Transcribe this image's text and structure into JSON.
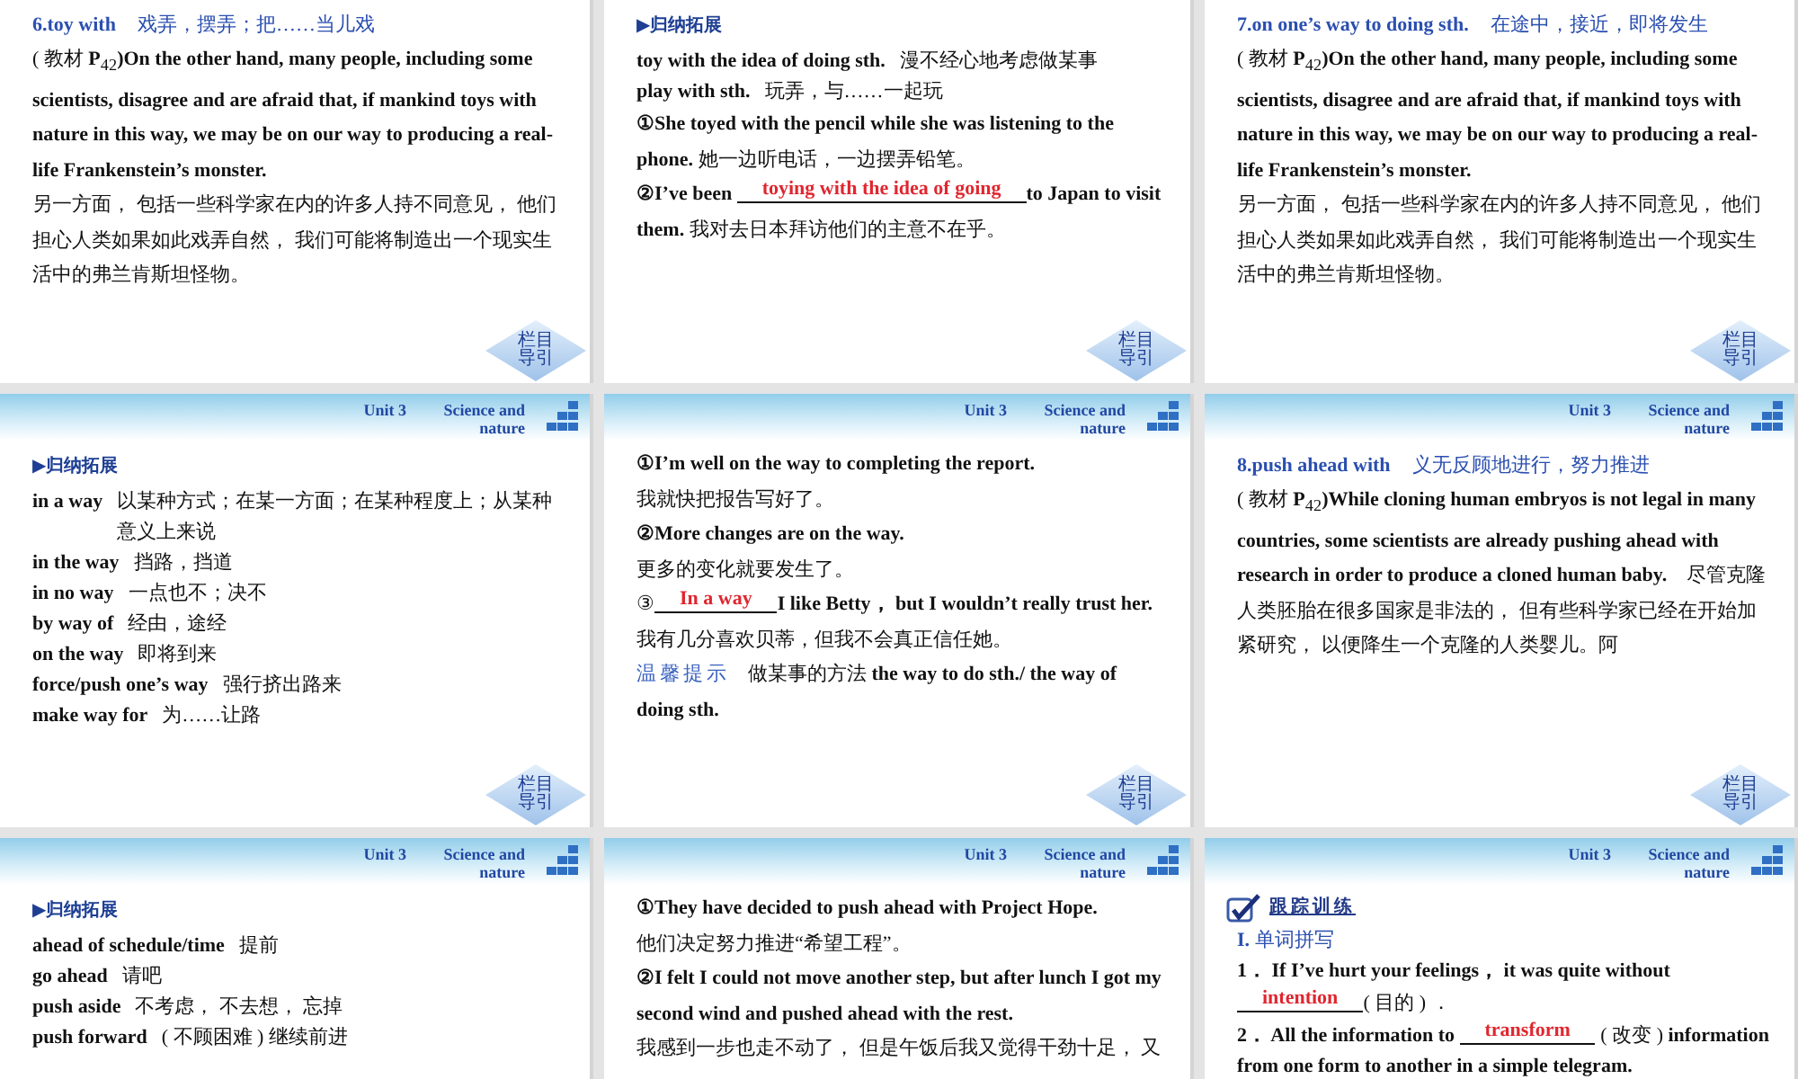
{
  "slides": [
    {
      "nav": "栏目导引",
      "lines": [
        {
          "kind": "heading",
          "term": "6.toy with",
          "meaning": "戏弄，摆弄；把……当儿戏"
        },
        {
          "kind": "para",
          "text": "( 教材 **P**$_{42}$**)On the other hand, many people, including some scientists, disagree and are afraid that, if mankind toys with nature in this way, we may be on our way to producing a real-life Frankenstein’s monster.**"
        },
        {
          "kind": "para",
          "text": "另一方面， 包括一些科学家在内的许多人持不同意见， 他们担心人类如果如此戏弄自然， 我们可能将制造出一个现实生活中的弗兰肯斯坦怪物。"
        }
      ]
    },
    {
      "nav": "栏目导引",
      "lines": [
        {
          "kind": "section",
          "text": "▶归纳拓展"
        },
        {
          "kind": "term",
          "term": "toy with the idea of doing sth.",
          "meaning": "漫不经心地考虑做某事"
        },
        {
          "kind": "term",
          "term": "play with sth.",
          "meaning": "玩弄，与……一起玩"
        },
        {
          "kind": "para",
          "text": "**①She toyed with the pencil while she was listening to the phone.** 她一边听电话，一边摆弄铅笔。"
        },
        {
          "kind": "fill",
          "before": "**②I’ve been** ",
          "answer": "toying with the idea of going",
          "after": "**to Japan to visit them.** 我对去日本拜访他们的主意不在乎。"
        }
      ]
    },
    {
      "nav": "栏目导引",
      "lines": [
        {
          "kind": "heading",
          "term": "7.on one’s way to doing sth.",
          "meaning": "在途中，接近，即将发生"
        },
        {
          "kind": "para",
          "text": "( 教材 **P**$_{42}$**)On the other hand, many people, including some scientists, disagree and are afraid that, if mankind toys with nature in this way, we may be on our way to producing a real-life Frankenstein’s monster.**"
        },
        {
          "kind": "para",
          "text": "另一方面， 包括一些科学家在内的许多人持不同意见， 他们担心人类如果如此戏弄自然， 我们可能将制造出一个现实生活中的弗兰肯斯坦怪物。"
        }
      ]
    },
    {
      "header": {
        "unit": "Unit 3",
        "topic": "Science and nature"
      },
      "nav": "栏目导引",
      "lines": [
        {
          "kind": "section",
          "text": "▶归纳拓展"
        },
        {
          "kind": "term",
          "term": "in a way",
          "meaning": "以某种方式；在某一方面；在某种程度上；从某种意义上来说"
        },
        {
          "kind": "term",
          "term": "in the way",
          "meaning": "挡路，挡道"
        },
        {
          "kind": "term",
          "term": "in no way",
          "meaning": "一点也不；决不"
        },
        {
          "kind": "term",
          "term": "by way of",
          "meaning": "经由，途经"
        },
        {
          "kind": "term",
          "term": "on the way",
          "meaning": "即将到来"
        },
        {
          "kind": "term",
          "term": "force/push one’s way",
          "meaning": "强行挤出路来"
        },
        {
          "kind": "term",
          "term": "make way for",
          "meaning": "为……让路"
        }
      ]
    },
    {
      "header": {
        "unit": "Unit 3",
        "topic": "Science and nature"
      },
      "nav": "栏目导引",
      "lines": [
        {
          "kind": "para",
          "text": "**①I’m well on the way to completing the report.**"
        },
        {
          "kind": "para",
          "text": "我就快把报告写好了。"
        },
        {
          "kind": "para",
          "text": "**②More changes are on the way.**"
        },
        {
          "kind": "para",
          "text": "更多的变化就要发生了。"
        },
        {
          "kind": "fill",
          "before": "③",
          "answer": "In a way",
          "after": "**I like Betty， but I wouldn’t really trust her.**"
        },
        {
          "kind": "para",
          "text": "我有几分喜欢贝蒂，但我不会真正信任她。"
        },
        {
          "kind": "tip",
          "label": "温馨提示",
          "text": "做某事的方法 **the way to do sth./ the way of doing sth.**"
        }
      ]
    },
    {
      "header": {
        "unit": "Unit 3",
        "topic": "Science and nature"
      },
      "nav": "栏目导引",
      "lines": [
        {
          "kind": "heading",
          "term": "8.push ahead with",
          "meaning": "义无反顾地进行，努力推进"
        },
        {
          "kind": "para",
          "text": "( 教材 **P**$_{42}$**)While cloning human embryos is not legal in many countries, some scientists are already pushing ahead with research in order to produce a cloned human baby.**　尽管克隆人类胚胎在很多国家是非法的， 但有些科学家已经在开始加紧研究， 以便降生一个克隆的人类婴儿。阿"
        }
      ]
    },
    {
      "header": {
        "unit": "Unit 3",
        "topic": "Science and nature"
      },
      "lines": [
        {
          "kind": "section",
          "text": "▶归纳拓展"
        },
        {
          "kind": "term",
          "term": "ahead of schedule/time",
          "meaning": "提前"
        },
        {
          "kind": "term",
          "term": "go ahead",
          "meaning": "请吧"
        },
        {
          "kind": "term",
          "term": "push aside",
          "meaning": "不考虑， 不去想， 忘掉"
        },
        {
          "kind": "term",
          "term": "push forward",
          "meaning": "( 不顾困难 ) 继续前进"
        }
      ]
    },
    {
      "header": {
        "unit": "Unit 3",
        "topic": "Science and nature"
      },
      "lines": [
        {
          "kind": "para",
          "text": "**①They have decided to push ahead with Project Hope.**"
        },
        {
          "kind": "para",
          "text": "他们决定努力推进“希望工程”。"
        },
        {
          "kind": "para",
          "text": "**②I felt I could not move another step, but after lunch I got my second wind and pushed ahead with the rest.**"
        },
        {
          "kind": "para",
          "text": "我感到一步也走不动了， 但是午饭后我又觉得干劲十足， 又"
        }
      ]
    },
    {
      "header": {
        "unit": "Unit 3",
        "topic": "Science and nature"
      },
      "lines": [
        {
          "kind": "practice",
          "text": "跟踪训练"
        },
        {
          "kind": "subhead",
          "text": "**I.** 单词拼写"
        },
        {
          "kind": "exercise",
          "before": "**1． If I’ve hurt your feelings， it was quite without**",
          "answer": "intention",
          "after": "( 目的 ) ．"
        },
        {
          "kind": "exercise",
          "before": "**2． All the information to** ",
          "answer": "transform",
          "after": " ( 改变 ) **information from one form to another in a simple telegram.**"
        }
      ]
    }
  ]
}
